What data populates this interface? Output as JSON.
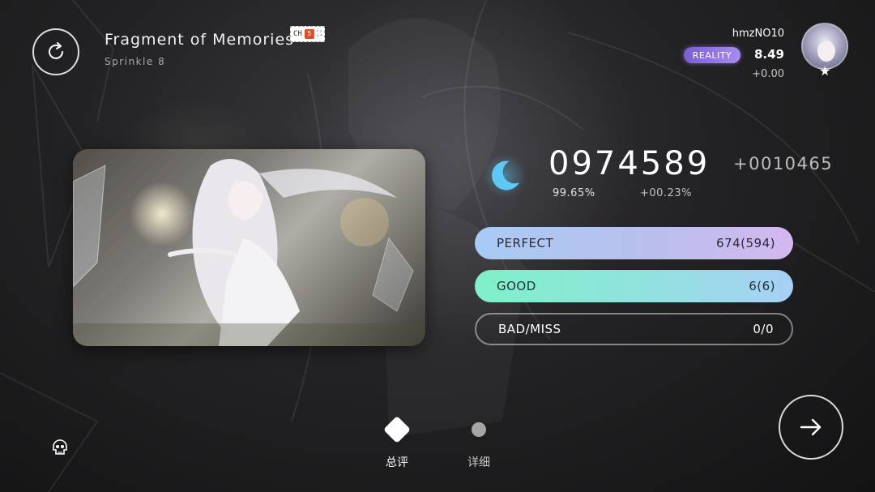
{
  "song": {
    "title": "Fragment of Memories",
    "difficulty": "Sprinkle 8",
    "badge_text": "CH"
  },
  "player": {
    "name": "hmzNO10",
    "rank_badge": "REALITY",
    "rating": "8.49",
    "rating_delta": "+0.00",
    "avatar_star": "★"
  },
  "result": {
    "score": "0974589",
    "score_delta": "+0010465",
    "accuracy": "99.65%",
    "accuracy_delta": "+00.23%"
  },
  "judgements": [
    {
      "label": "PERFECT",
      "value": "674(594)"
    },
    {
      "label": "GOOD",
      "value": "6(6)"
    },
    {
      "label": "BAD/MISS",
      "value": "0/0"
    }
  ],
  "tabs": [
    {
      "label": "总评",
      "icon": "diamond-icon",
      "active": true
    },
    {
      "label": "详细",
      "icon": "dot-icon",
      "active": false
    }
  ],
  "icons": {
    "retry": "retry-icon",
    "next": "arrow-right-icon",
    "mod": "skull-icon",
    "grade": "moon-icon"
  },
  "colors": {
    "perfect_gradient": [
      "#a8cbf5",
      "#d4b8f0"
    ],
    "good_gradient": [
      "#7ff0c8",
      "#a8cff5"
    ],
    "reality_badge": "#8f70e0",
    "moon": "#5ec8f5"
  }
}
